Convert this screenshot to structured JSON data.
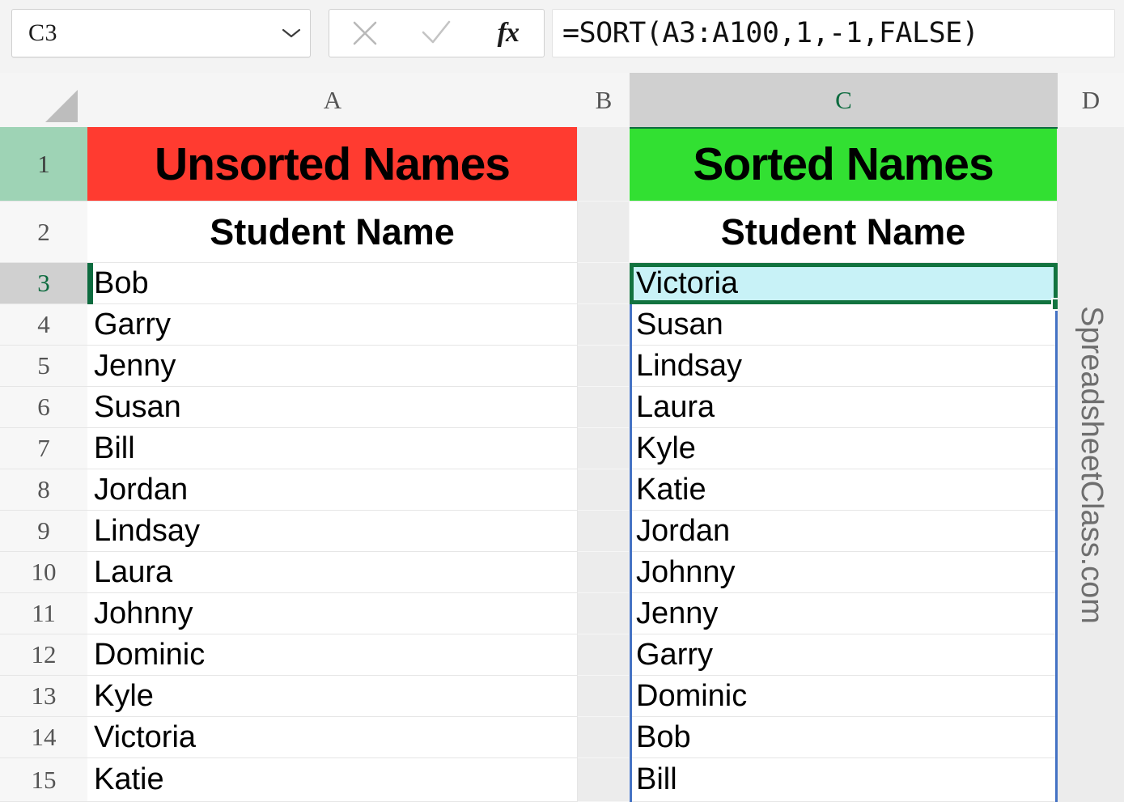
{
  "formula_bar": {
    "name_box_value": "C3",
    "name_box_placeholder": "Name Box",
    "cancel_icon": "close-x-icon",
    "enter_icon": "checkmark-icon",
    "function_icon": "fx-icon",
    "fx_label": "fx",
    "formula": "=SORT(A3:A100,1,-1,FALSE)"
  },
  "grid": {
    "column_headers": [
      "A",
      "B",
      "C",
      "D"
    ],
    "selected_column": "C",
    "row_headers": [
      "1",
      "2",
      "3",
      "4",
      "5",
      "6",
      "7",
      "8",
      "9",
      "10",
      "11",
      "12",
      "13",
      "14",
      "15"
    ],
    "selected_row": "3",
    "tinted_row": "1",
    "active_cell": "C3",
    "titles": {
      "a1": "Unsorted Names",
      "c1": "Sorted Names"
    },
    "subheaders": {
      "a2": "Student Name",
      "c2": "Student Name"
    },
    "column_a_values": [
      "Bob",
      "Garry",
      "Jenny",
      "Susan",
      "Bill",
      "Jordan",
      "Lindsay",
      "Laura",
      "Johnny",
      "Dominic",
      "Kyle",
      "Victoria",
      "Katie"
    ],
    "column_c_values": [
      "Victoria",
      "Susan",
      "Lindsay",
      "Laura",
      "Kyle",
      "Katie",
      "Jordan",
      "Johnny",
      "Jenny",
      "Garry",
      "Dominic",
      "Bob",
      "Bill"
    ]
  },
  "watermark": {
    "text": "SpreadsheetClass.com"
  },
  "colors": {
    "unsorted_header_fill": "#ff3b30",
    "sorted_header_fill": "#32e032",
    "active_cell_fill": "#c8f2f7",
    "selection_border": "#12733f",
    "spill_border": "#4472c4",
    "row1_header_tint": "#9ed3b5"
  }
}
